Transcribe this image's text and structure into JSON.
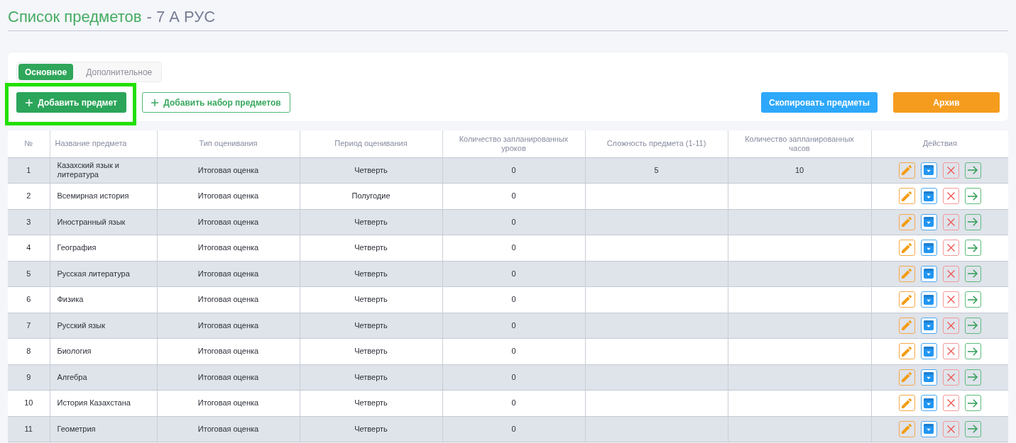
{
  "page": {
    "title": "Список предметов",
    "class_label": "- 7 А РУС"
  },
  "tabs": [
    {
      "label": "Основное",
      "selected": true
    },
    {
      "label": "Дополнительное",
      "selected": false
    }
  ],
  "toolbar": {
    "left_buttons": [
      {
        "label": "Добавить предмет",
        "kind": "add",
        "highlighted": true
      },
      {
        "label": "Добавить набор предметов",
        "kind": "addset",
        "highlighted": false
      }
    ],
    "right_buttons": [
      {
        "label": "Скопировать предметы",
        "kind": "copy",
        "highlighted": false
      },
      {
        "label": "Архив",
        "kind": "archive",
        "highlighted": false
      }
    ]
  },
  "table": {
    "columns": [
      "№",
      "Название предмета",
      "Тип оценивания",
      "Период оценивания",
      "Количество запланированных уроков",
      "Сложность предмета (1-11)",
      "Количество запланированных часов",
      "Действия"
    ],
    "rows": [
      {
        "number": "1",
        "name": "Казахский язык и литература",
        "grading_type": "Итоговая оценка",
        "grading_period": "Четверть",
        "planned_lessons": "0",
        "difficulty": "5",
        "planned_hours": "10"
      },
      {
        "number": "2",
        "name": "Всемирная история",
        "grading_type": "Итоговая оценка",
        "grading_period": "Полугодие",
        "planned_lessons": "0"
      },
      {
        "number": "3",
        "name": "Иностранный язык",
        "grading_type": "Итоговая оценка",
        "grading_period": "Четверть",
        "planned_lessons": "0"
      },
      {
        "number": "4",
        "name": "География",
        "grading_type": "Итоговая оценка",
        "grading_period": "Четверть",
        "planned_lessons": "0"
      },
      {
        "number": "5",
        "name": "Русская литература",
        "grading_type": "Итоговая оценка",
        "grading_period": "Четверть",
        "planned_lessons": "0"
      },
      {
        "number": "6",
        "name": "Физика",
        "grading_type": "Итоговая оценка",
        "grading_period": "Четверть",
        "planned_lessons": "0"
      },
      {
        "number": "7",
        "name": "Русский язык",
        "grading_type": "Итоговая оценка",
        "grading_period": "Четверть",
        "planned_lessons": "0"
      },
      {
        "number": "8",
        "name": "Биология",
        "grading_type": "Итоговая оценка",
        "grading_period": "Четверть",
        "planned_lessons": "0"
      },
      {
        "number": "9",
        "name": "Алгебра",
        "grading_type": "Итоговая оценка",
        "grading_period": "Четверть",
        "planned_lessons": "0"
      },
      {
        "number": "10",
        "name": "История Казахстана",
        "grading_type": "Итоговая оценка",
        "grading_period": "Четверть",
        "planned_lessons": "0"
      },
      {
        "number": "11",
        "name": "Геометрия",
        "grading_type": "Итоговая оценка",
        "grading_period": "Четверть",
        "planned_lessons": "0"
      }
    ]
  }
}
